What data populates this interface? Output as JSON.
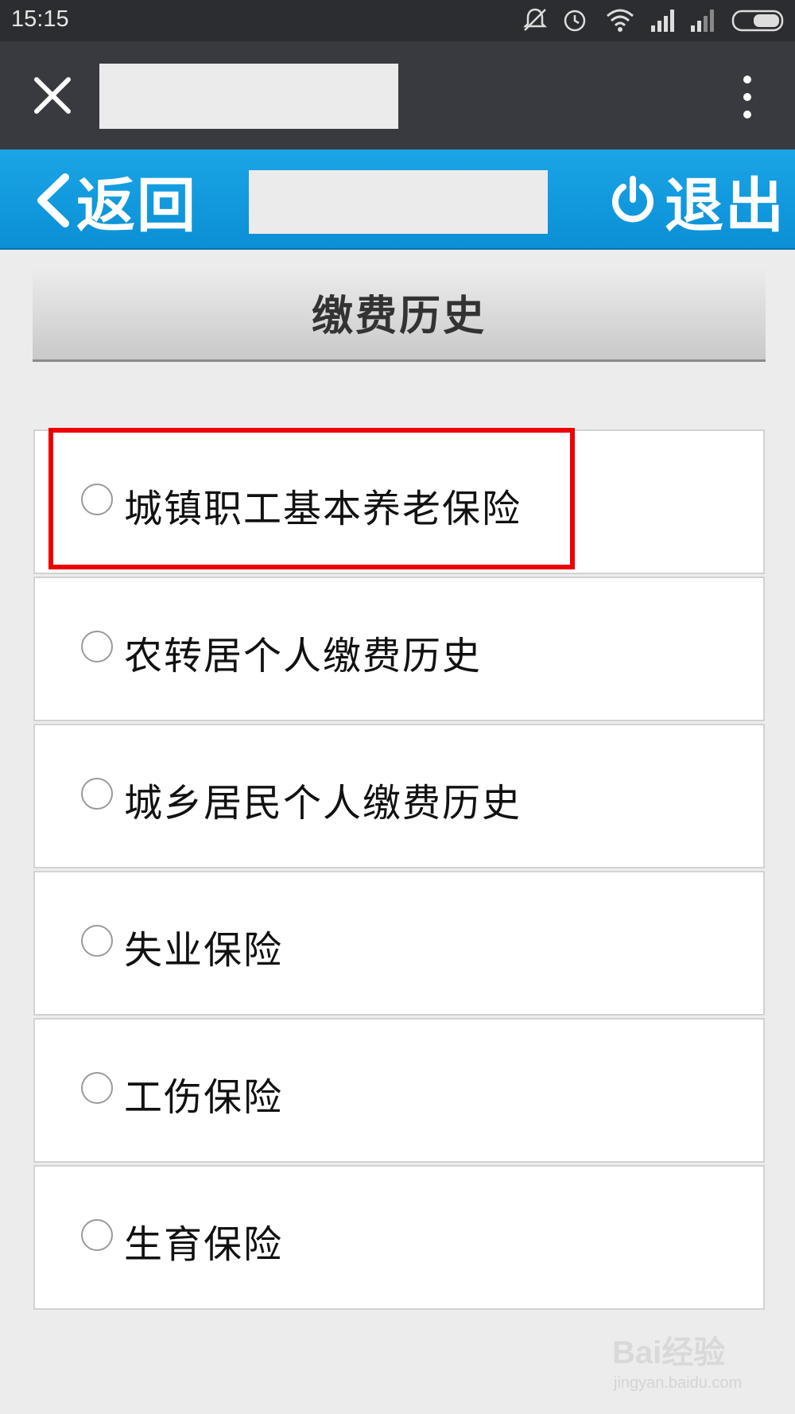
{
  "status_bar": {
    "time": "15:15",
    "icons": [
      "mute-icon",
      "alarm-icon",
      "wifi-icon",
      "signal-icon",
      "signal-icon",
      "battery-icon"
    ]
  },
  "app_bar": {
    "close_icon": "close-icon",
    "more_icon": "more-vertical-icon"
  },
  "nav_bar": {
    "back_label": "返回",
    "logout_label": "退出",
    "accent": "#0b8fd6"
  },
  "section": {
    "title": "缴费历史"
  },
  "options": [
    {
      "label": "城镇职工基本养老保险",
      "highlighted": true
    },
    {
      "label": "农转居个人缴费历史"
    },
    {
      "label": "城乡居民个人缴费历史"
    },
    {
      "label": "失业保险"
    },
    {
      "label": "工伤保险"
    },
    {
      "label": "生育保险"
    }
  ],
  "watermark": {
    "logo": "Bai经验",
    "url": "jingyan.baidu.com"
  }
}
